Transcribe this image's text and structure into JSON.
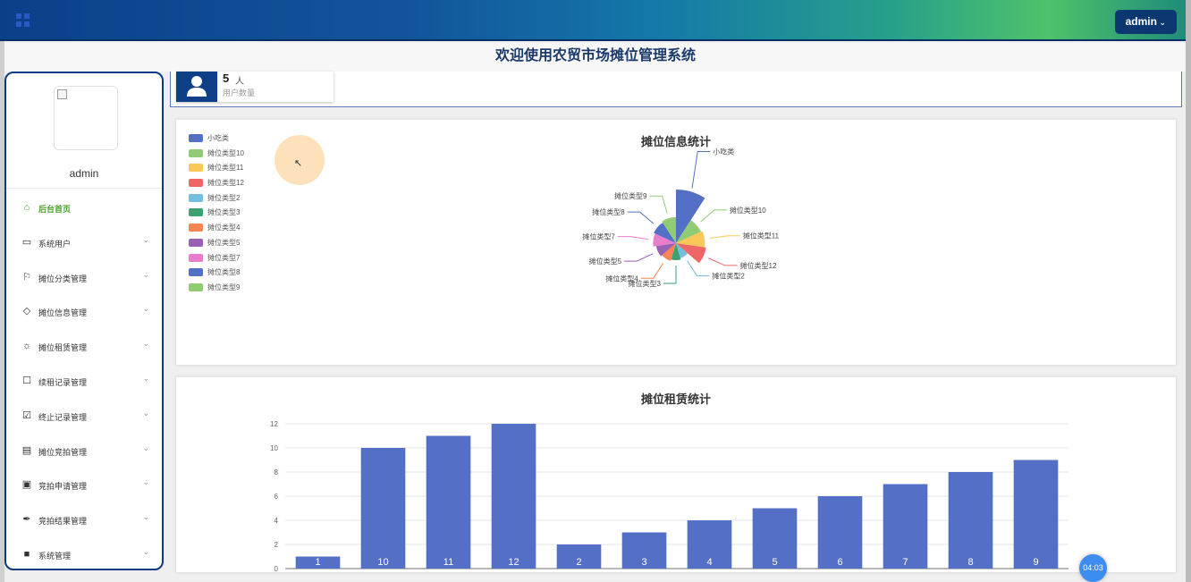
{
  "header": {
    "menu_icon": "grid-icon",
    "user_button_label": "admin",
    "user_button_icon": "chevron-down-icon",
    "system_title": "欢迎使用农贸市场摊位管理系统"
  },
  "sidebar": {
    "username": "admin",
    "items": [
      {
        "label": "后台首页",
        "icon": "home-icon",
        "active": true
      },
      {
        "label": "系统用户",
        "icon": "monitor-icon"
      },
      {
        "label": "摊位分类管理",
        "icon": "bookmark-icon"
      },
      {
        "label": "摊位信息管理",
        "icon": "tag-icon"
      },
      {
        "label": "摊位租赁管理",
        "icon": "sun-icon"
      },
      {
        "label": "续租记录管理",
        "icon": "inbox-icon"
      },
      {
        "label": "终止记录管理",
        "icon": "clipboard-icon"
      },
      {
        "label": "摊位竞拍管理",
        "icon": "message-icon"
      },
      {
        "label": "竞拍申请管理",
        "icon": "archive-icon"
      },
      {
        "label": "竞拍结果管理",
        "icon": "paperclip-icon"
      },
      {
        "label": "系统管理",
        "icon": "copy-icon"
      }
    ]
  },
  "stats": {
    "user_count_value": "5",
    "user_count_unit": "人",
    "user_count_caption": "用户数量",
    "icon": "user-icon"
  },
  "timer": "04:03",
  "colors": {
    "primary": "#0f3f87",
    "active_menu": "#4ba32a",
    "bar": "#5470c6"
  },
  "chart_data": [
    {
      "type": "pie",
      "title": "摊位信息统计",
      "rose": true,
      "legend_position": "top-left",
      "categories": [
        "小吃类",
        "摊位类型10",
        "摊位类型11",
        "摊位类型12",
        "摊位类型2",
        "摊位类型3",
        "摊位类型4",
        "摊位类型5",
        "摊位类型7",
        "摊位类型8",
        "摊位类型9"
      ],
      "values": [
        1,
        10,
        11,
        12,
        2,
        3,
        4,
        5,
        7,
        8,
        9
      ],
      "colors": [
        "#5470c6",
        "#91cc75",
        "#fac858",
        "#ee6666",
        "#73c0de",
        "#3ba272",
        "#fc8452",
        "#9a60b4",
        "#ea7ccc",
        "#5470c6",
        "#91cc75"
      ]
    },
    {
      "type": "bar",
      "title": "摊位租赁统计",
      "categories": [
        "1",
        "10",
        "11",
        "12",
        "2",
        "3",
        "4",
        "5",
        "6",
        "7",
        "8",
        "9"
      ],
      "values": [
        1,
        10,
        11,
        12,
        2,
        3,
        4,
        5,
        6,
        7,
        8,
        9
      ],
      "ylim": [
        0,
        12
      ],
      "yticks": [
        "0",
        "2",
        "4",
        "6",
        "8",
        "10",
        "12"
      ],
      "grid": true
    }
  ]
}
